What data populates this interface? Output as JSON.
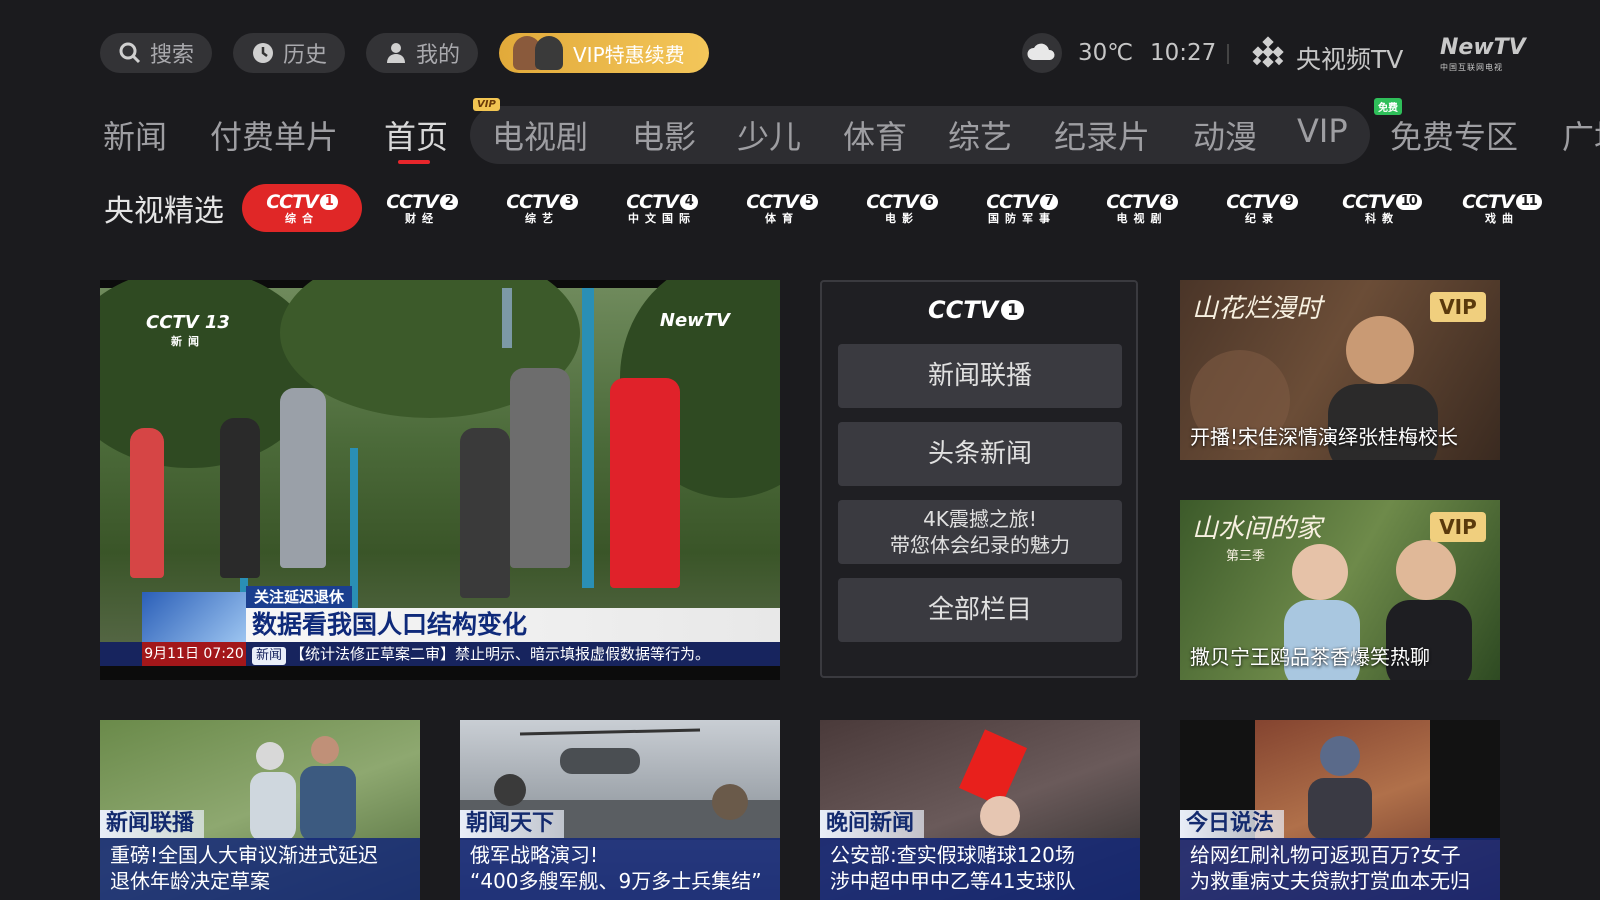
{
  "topbar": {
    "search_label": "搜索",
    "history_label": "历史",
    "mine_label": "我的",
    "vip_label": "VIP特惠续费",
    "temperature": "30℃",
    "time": "10:27",
    "brand": "央视频TV",
    "newtv": "NewTV",
    "newtv_sub": "中国互联网电视"
  },
  "nav": {
    "categories": [
      "新闻",
      "付费单片",
      "首页",
      "电视剧",
      "电影",
      "少儿",
      "体育",
      "综艺",
      "纪录片",
      "动漫",
      "VIP",
      "免费专区",
      "广场"
    ],
    "active_index": 2,
    "vip_badge": "VIP",
    "free_badge": "免费"
  },
  "channels": {
    "label": "央视精选",
    "items": [
      {
        "logo": "CCTV",
        "num": "1",
        "sub": "综合"
      },
      {
        "logo": "CCTV",
        "num": "2",
        "sub": "财经"
      },
      {
        "logo": "CCTV",
        "num": "3",
        "sub": "综艺"
      },
      {
        "logo": "CCTV",
        "num": "4",
        "sub": "中文国际"
      },
      {
        "logo": "CCTV",
        "num": "5",
        "sub": "体育"
      },
      {
        "logo": "CCTV",
        "num": "6",
        "sub": "电影"
      },
      {
        "logo": "CCTV",
        "num": "7",
        "sub": "国防军事"
      },
      {
        "logo": "CCTV",
        "num": "8",
        "sub": "电视剧"
      },
      {
        "logo": "CCTV",
        "num": "9",
        "sub": "纪录"
      },
      {
        "logo": "CCTV",
        "num": "10",
        "sub": "科教"
      },
      {
        "logo": "CCTV",
        "num": "11",
        "sub": "戏曲"
      }
    ],
    "active_index": 0
  },
  "video": {
    "channel_logo": "CCTV 13",
    "channel_sub": "新闻",
    "watermark": "NewTV",
    "lower_tag": "关注延迟退休",
    "lower_title": "数据看我国人口结构变化",
    "date": "9月11日 07:20",
    "ticker_tag": "新闻",
    "ticker": "【统计法修正草案二审】禁止明示、暗示填报虚假数据等行为。"
  },
  "quick_panel": {
    "logo": "CCTV",
    "logo_num": "1",
    "buttons": [
      "新闻联播",
      "头条新闻",
      "4K震撼之旅!\n带您体会纪录的魅力",
      "全部栏目"
    ]
  },
  "posters": [
    {
      "badge": "VIP",
      "brush_title": "山花烂漫时",
      "caption": "开播!宋佳深情演绎张桂梅校长"
    },
    {
      "badge": "VIP",
      "brush_title": "山水间的家",
      "brush_sub": "第三季",
      "caption": "撒贝宁王鸥品茶香爆笑热聊"
    }
  ],
  "cards": [
    {
      "tag": "新闻联播",
      "text": "重磅!全国人大审议渐进式延迟\n退休年龄决定草案"
    },
    {
      "tag": "朝闻天下",
      "text": "俄军战略演习!\n“400多艘军舰、9万多士兵集结”"
    },
    {
      "tag": "晚间新闻",
      "text": "公安部:查实假球赌球120场\n涉中超中甲中乙等41支球队"
    },
    {
      "tag": "今日说法",
      "text": "给网红刷礼物可返现百万?女子\n为救重病丈夫贷款打赏血本无归"
    }
  ]
}
